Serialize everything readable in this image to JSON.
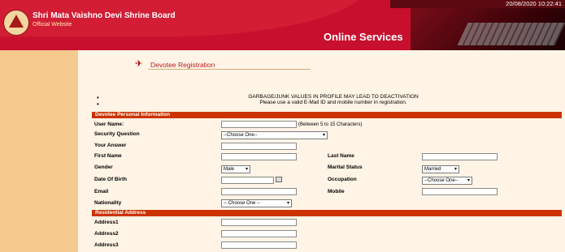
{
  "header": {
    "title": "Shri Mata Vaishno Devi Shrine Board",
    "subtitle": "Official Website",
    "datetime": "20/08/2020 10:22:41",
    "banner": "Online Services"
  },
  "page": {
    "title": "Devotee Registration",
    "notice_line1": "GARBAGE/JUNK VALUES IN PROFILE MAY LEAD TO DEACTIVATION",
    "notice_line2": "Please use a valid E-Mail ID and mobile number in registration.",
    "bullet": "•"
  },
  "personal": {
    "section": "Devotee Personal Information",
    "username_label": "User Name:",
    "username_hint": "(Between 5 to 15 Characters)",
    "security_label": "Security Question",
    "security_value": "--Choose One--",
    "answer_label": "Your Answer",
    "firstname_label": "First Name",
    "lastname_label": "Last Name",
    "gender_label": "Gender",
    "gender_value": "Male",
    "marital_label": "Marital Status",
    "marital_value": "Married",
    "dob_label": "Date Of Birth",
    "occupation_label": "Occupation",
    "occupation_value": "--Choose One--",
    "email_label": "Email",
    "mobile_label": "Mobile",
    "nationality_label": "Nationality",
    "nationality_value": "-- Choose One --"
  },
  "address": {
    "section": "Residential Address",
    "address1_label": "Address1",
    "address2_label": "Address2",
    "address3_label": "Address3"
  }
}
